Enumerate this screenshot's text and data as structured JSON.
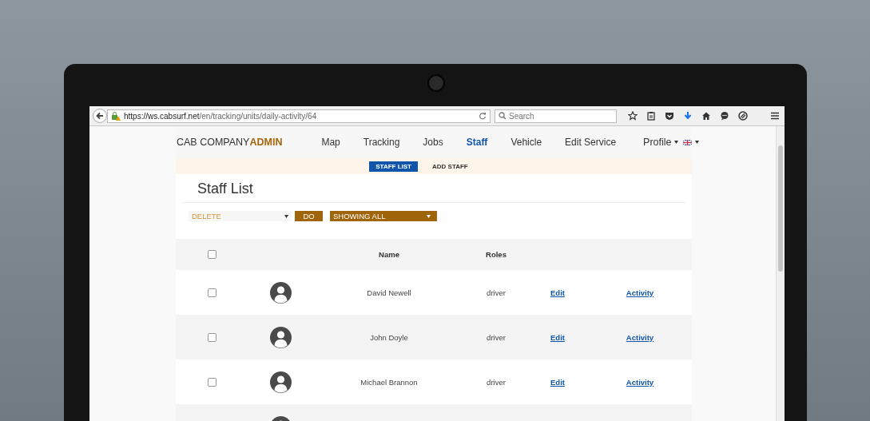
{
  "browser": {
    "url_host": "https://ws.cabsurf.net",
    "url_path": "/en/tracking/units/daily-activity/64",
    "search": {
      "placeholder": "Search"
    }
  },
  "brand": {
    "name": "CAB COMPANY",
    "suffix": "ADMIN"
  },
  "nav": [
    {
      "label": "Map",
      "selected": false
    },
    {
      "label": "Tracking",
      "selected": false
    },
    {
      "label": "Jobs",
      "selected": false
    },
    {
      "label": "Staff",
      "selected": true
    },
    {
      "label": "Vehicle",
      "selected": false
    },
    {
      "label": "Edit Service",
      "selected": false
    }
  ],
  "profile": {
    "label": "Profile"
  },
  "subnav": [
    {
      "label": "STAFF LIST",
      "selected": true
    },
    {
      "label": "ADD STAFF",
      "selected": false
    }
  ],
  "page_title": "Staff List",
  "bulk_action": {
    "value": "DELETE",
    "button": "DO"
  },
  "filter": {
    "value": "SHOWING ALL"
  },
  "table": {
    "select_all": {
      "checked": false
    },
    "columns": [
      "Name",
      "Roles"
    ],
    "rows": [
      {
        "checked": false,
        "name": "David Newell",
        "role": "driver",
        "edit": "Edit",
        "activity": "Activity"
      },
      {
        "checked": false,
        "name": "John Doyle",
        "role": "driver",
        "edit": "Edit",
        "activity": "Activity"
      },
      {
        "checked": false,
        "name": "Michael Brannon",
        "role": "driver",
        "edit": "Edit",
        "activity": "Activity"
      }
    ]
  }
}
